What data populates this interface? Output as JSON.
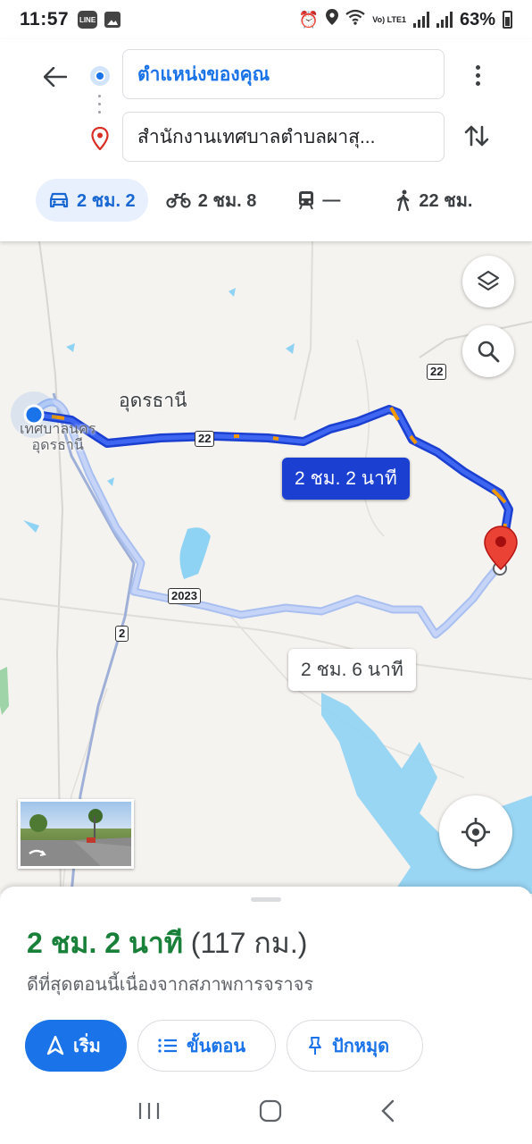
{
  "status_bar": {
    "time": "11:57",
    "badge_line": "LINE",
    "lte_label": "Vo) LTE1",
    "battery": "63%"
  },
  "directions": {
    "origin": "ตำแหน่งของคุณ",
    "destination": "สำนักงานเทศบาลตำบลผาสุ..."
  },
  "modes": [
    {
      "name": "car",
      "label": "2 ชม. 2",
      "active": true
    },
    {
      "name": "motorcycle",
      "label": "2 ชม. 8"
    },
    {
      "name": "transit",
      "label": "—"
    },
    {
      "name": "walk",
      "label": "22 ชม."
    }
  ],
  "map": {
    "province_label": "อุดรธานี",
    "city_label_line1": "เทศบาลนคร",
    "city_label_line2": "อุดรธานี",
    "route_primary": "2 ชม. 2 นาที",
    "route_alt": "2 ชม. 6 นาที",
    "road_shields": [
      "22",
      "22",
      "2023",
      "2"
    ]
  },
  "summary": {
    "duration": "2 ชม. 2 นาที",
    "distance": "(117 กม.)",
    "note": "ดีที่สุดตอนนี้เนื่องจากสภาพการจราจร"
  },
  "actions": {
    "start": "เริ่ม",
    "steps": "ขั้นตอน",
    "pin": "ปักหมุด"
  },
  "colors": {
    "accent": "#1a73e8",
    "route_primary": "#1a3fd1",
    "eta_green": "#188038",
    "destination_pin": "#ea4335"
  }
}
